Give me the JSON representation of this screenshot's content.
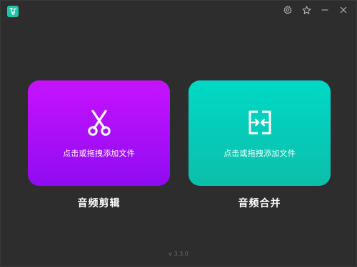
{
  "window": {
    "controls": [
      {
        "icon": "gear-icon"
      },
      {
        "icon": "star-icon"
      },
      {
        "icon": "minimize-icon"
      },
      {
        "icon": "close-icon"
      }
    ]
  },
  "cards": {
    "edit": {
      "hint": "点击或拖拽添加文件",
      "label": "音频剪辑",
      "icon": "scissors-icon",
      "gradient": [
        "#c712ff",
        "#8f0cf1"
      ]
    },
    "merge": {
      "hint": "点击或拖拽添加文件",
      "label": "音频合并",
      "icon": "merge-icon",
      "gradient": [
        "#00d8c6",
        "#0bbfaa"
      ]
    }
  },
  "footer": {
    "version": "v 3.3.0"
  },
  "colors": {
    "background": "#2d2d2d",
    "logo": "#19c7a8"
  }
}
